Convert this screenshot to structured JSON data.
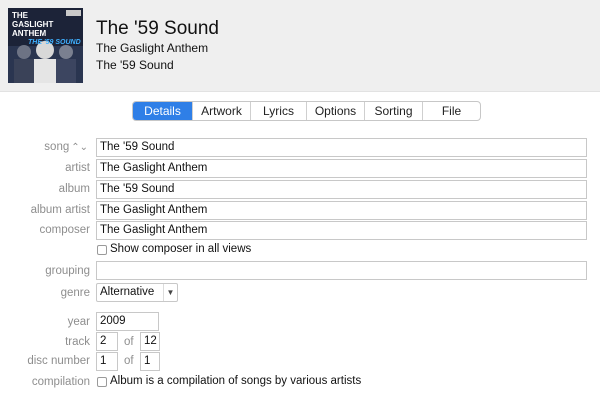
{
  "header": {
    "title": "The '59 Sound",
    "artist": "The Gaslight Anthem",
    "album": "The '59 Sound",
    "artwork_text": [
      "THE",
      "GASLIGHT",
      "ANTHEM",
      "THE '59 SOUND"
    ]
  },
  "tabs": [
    {
      "label": "Details",
      "active": true
    },
    {
      "label": "Artwork",
      "active": false
    },
    {
      "label": "Lyrics",
      "active": false
    },
    {
      "label": "Options",
      "active": false
    },
    {
      "label": "Sorting",
      "active": false
    },
    {
      "label": "File",
      "active": false
    }
  ],
  "form": {
    "song_label": "song",
    "song_value": "The '59 Sound",
    "artist_label": "artist",
    "artist_value": "The Gaslight Anthem",
    "album_label": "album",
    "album_value": "The '59 Sound",
    "album_artist_label": "album artist",
    "album_artist_value": "The Gaslight Anthem",
    "composer_label": "composer",
    "composer_value": "The Gaslight Anthem",
    "show_composer_text": "Show composer in all views",
    "grouping_label": "grouping",
    "grouping_value": "",
    "genre_label": "genre",
    "genre_value": "Alternative",
    "year_label": "year",
    "year_value": "2009",
    "track_label": "track",
    "track_value": "2",
    "track_of_label": "of",
    "track_total": "12",
    "disc_label": "disc number",
    "disc_value": "1",
    "disc_of_label": "of",
    "disc_total": "1",
    "compilation_label": "compilation",
    "compilation_text": "Album is a compilation of songs by various artists"
  },
  "colors": {
    "accent": "#2f7fe7",
    "header_bg": "#efefef",
    "label": "#8e8e8e"
  }
}
